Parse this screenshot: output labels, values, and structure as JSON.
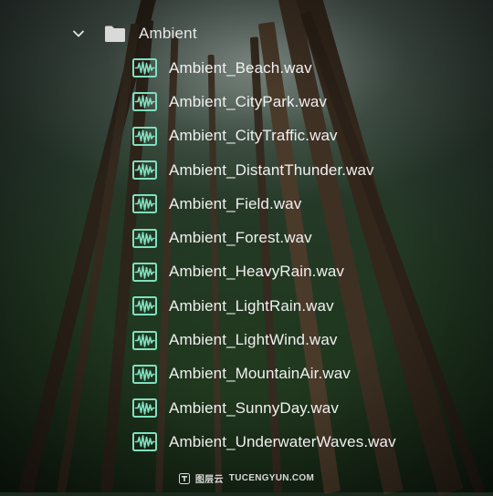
{
  "folder": {
    "label": "Ambient",
    "expanded": true,
    "icon": "folder-icon"
  },
  "files": [
    {
      "name": "Ambient_Beach.wav",
      "icon": "wav-file-icon"
    },
    {
      "name": "Ambient_CityPark.wav",
      "icon": "wav-file-icon"
    },
    {
      "name": "Ambient_CityTraffic.wav",
      "icon": "wav-file-icon"
    },
    {
      "name": "Ambient_DistantThunder.wav",
      "icon": "wav-file-icon"
    },
    {
      "name": "Ambient_Field.wav",
      "icon": "wav-file-icon"
    },
    {
      "name": "Ambient_Forest.wav",
      "icon": "wav-file-icon"
    },
    {
      "name": "Ambient_HeavyRain.wav",
      "icon": "wav-file-icon"
    },
    {
      "name": "Ambient_LightRain.wav",
      "icon": "wav-file-icon"
    },
    {
      "name": "Ambient_LightWind.wav",
      "icon": "wav-file-icon"
    },
    {
      "name": "Ambient_MountainAir.wav",
      "icon": "wav-file-icon"
    },
    {
      "name": "Ambient_SunnyDay.wav",
      "icon": "wav-file-icon"
    },
    {
      "name": "Ambient_UnderwaterWaves.wav",
      "icon": "wav-file-icon"
    }
  ],
  "watermark": {
    "cn": "图层云",
    "en": "TUCENGYUN.COM"
  },
  "colors": {
    "wav_icon": "#7fe0c0",
    "text": "#f0f0f0",
    "folder_icon": "#d9d9d9"
  }
}
